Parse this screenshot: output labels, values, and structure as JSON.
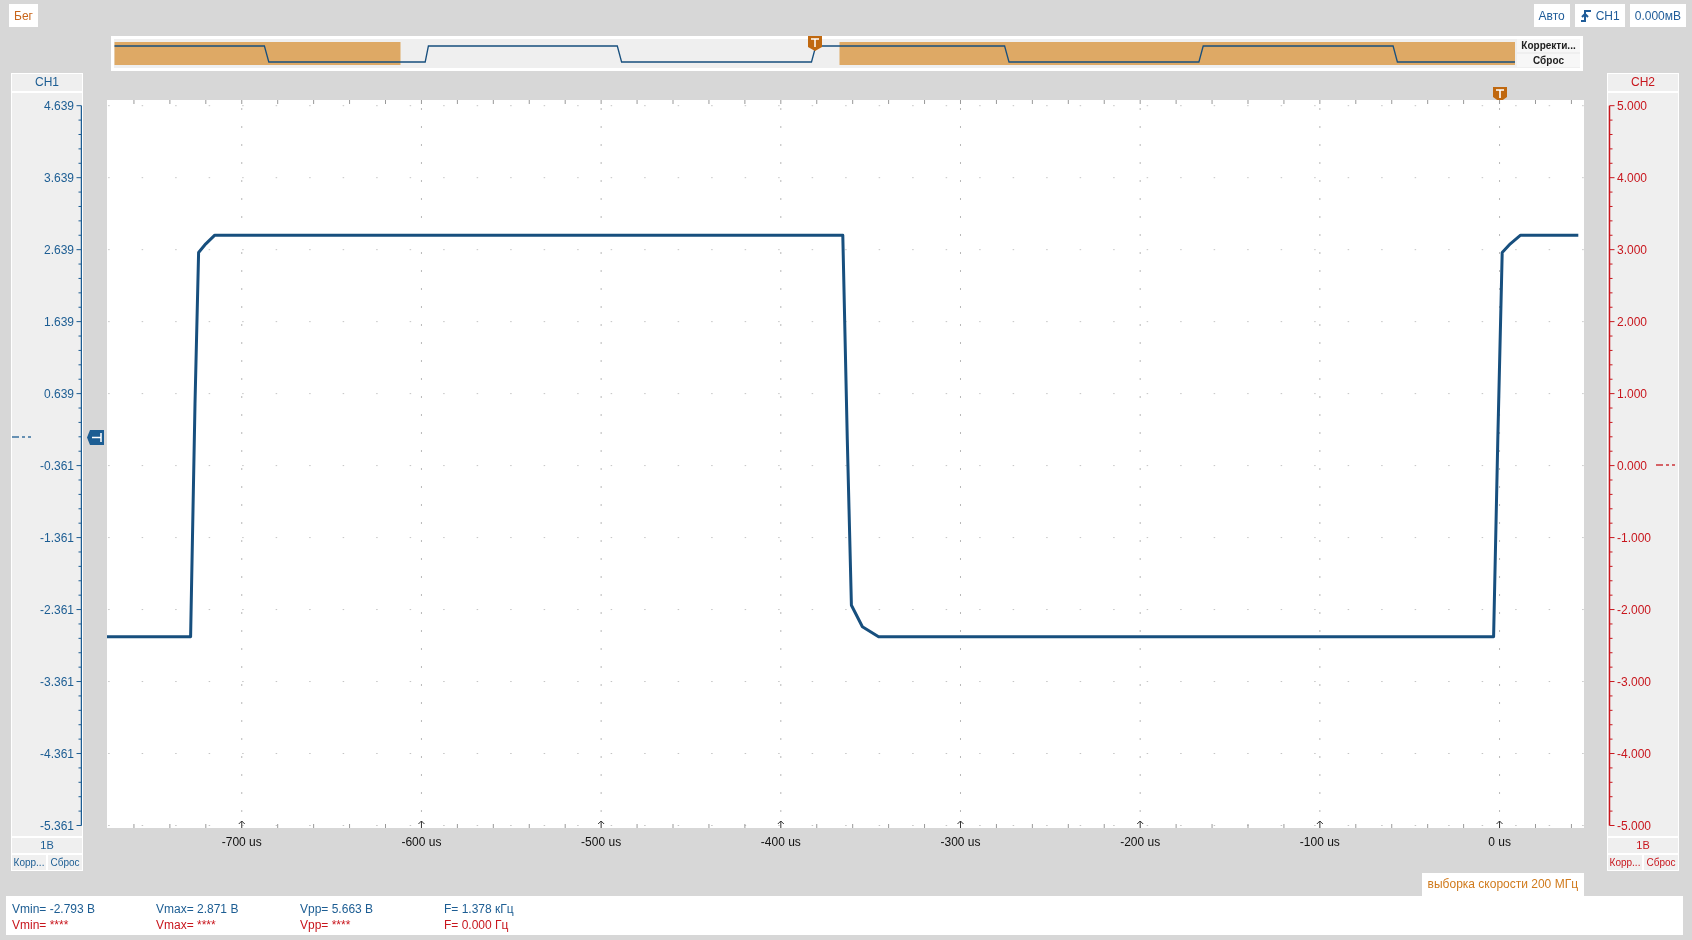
{
  "status": "Бег",
  "top_controls": {
    "mode": "Авто",
    "trigger_source": "CH1",
    "trigger_level": "0.000мВ"
  },
  "overview": {
    "buttons": [
      "Корректи...",
      "Сброс"
    ]
  },
  "channels": [
    {
      "kind": "ch1",
      "title": "CH1",
      "scale": "1В",
      "buttons": [
        "Корр...",
        "Сброс"
      ]
    },
    {
      "kind": "ch2",
      "title": "CH2",
      "ticks": [
        "5.000",
        "4.000",
        "3.000",
        "2.000",
        "1.000",
        "0.000",
        "-1.000",
        "-2.000",
        "-3.000",
        "-4.000",
        "-5.000"
      ],
      "scale": "1В",
      "buttons": [
        "Корр...",
        "Сброс"
      ]
    }
  ],
  "chart_data": {
    "type": "line",
    "x": [
      -775,
      -728.5,
      -726,
      -724,
      -720,
      -715,
      -365.5,
      -363,
      -360.7,
      -354.6,
      -345.6,
      -3.3,
      -1,
      1.5,
      6,
      11.7,
      43.8
    ],
    "series": [
      {
        "color": "#174f7e",
        "values": [
          -2.74,
          -2.74,
          0.5,
          2.6,
          2.72,
          2.84,
          2.84,
          0,
          -2.3,
          -2.6,
          -2.74,
          -2.74,
          0,
          2.6,
          2.72,
          2.84,
          2.84
        ]
      }
    ],
    "xlim": [
      -775,
      47
    ],
    "ylim": [
      -5.361,
      4.639
    ],
    "xticks": [
      {
        "value": -700,
        "label": "-700 us"
      },
      {
        "value": -600,
        "label": "-600 us"
      },
      {
        "value": -500,
        "label": "-500 us"
      },
      {
        "value": -400,
        "label": "-400 us"
      },
      {
        "value": -300,
        "label": "-300 us"
      },
      {
        "value": -200,
        "label": "-200 us"
      },
      {
        "value": -100,
        "label": "-100 us"
      },
      {
        "value": 0,
        "label": "0 us"
      }
    ],
    "yticks": [
      {
        "value": 4.639,
        "label": "4.639"
      },
      {
        "value": 3.639,
        "label": "3.639"
      },
      {
        "value": 2.639,
        "label": "2.639"
      },
      {
        "value": 1.639,
        "label": "1.639"
      },
      {
        "value": 0.639,
        "label": "0.639"
      },
      {
        "value": -0.361,
        "label": "-0.361"
      },
      {
        "value": -1.361,
        "label": "-1.361"
      },
      {
        "value": -2.361,
        "label": "-2.361"
      },
      {
        "value": -3.361,
        "label": "-3.361"
      },
      {
        "value": -4.361,
        "label": "-4.361"
      },
      {
        "value": -5.361,
        "label": "-5.361"
      }
    ],
    "grid": true
  },
  "sample_rate": "выборка скорости 200 МГц",
  "measurements": [
    {
      "kind": "ch1",
      "items": [
        "Vmin= -2.793 В",
        "Vmax= 2.871 В",
        "Vpp= 5.663 В",
        "F= 1.378 кГц"
      ]
    },
    {
      "kind": "ch2",
      "items": [
        "Vmin= ****",
        "Vmax= ****",
        "Vpp= ****",
        "F= 0.000 Гц"
      ]
    }
  ]
}
